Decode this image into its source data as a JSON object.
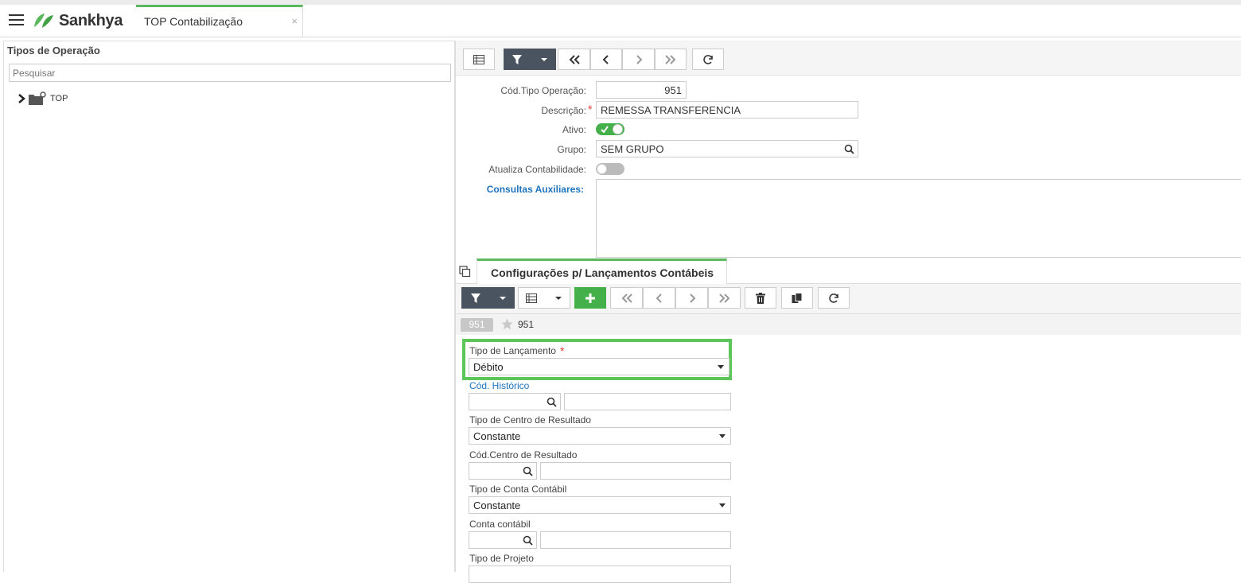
{
  "app": {
    "brand": "Sankhya",
    "tab_label": "TOP Contabilização",
    "tab_close": "×"
  },
  "left": {
    "title": "Tipos de Operação",
    "search_placeholder": "Pesquisar",
    "tree": [
      {
        "label": "TOP"
      }
    ]
  },
  "form": {
    "cod_label": "Cód.Tipo Operação:",
    "cod_value": "951",
    "desc_label": "Descrição:",
    "desc_value": "REMESSA TRANSFERENCIA",
    "ativo_label": "Ativo:",
    "ativo_on": true,
    "grupo_label": "Grupo:",
    "grupo_value": "SEM GRUPO",
    "atualiza_label": "Atualiza Contabilidade:",
    "atualiza_on": false,
    "consultas_label": "Consultas Auxiliares:"
  },
  "subtab": {
    "label": "Configurações p/ Lançamentos Contábeis"
  },
  "record": {
    "badge": "951",
    "label": "951"
  },
  "detail": {
    "tipo_lanc_label": "Tipo de Lançamento",
    "tipo_lanc_value": "Débito",
    "cod_hist_label": "Cód. Histórico",
    "tipo_centro_label": "Tipo de Centro de Resultado",
    "tipo_centro_value": "Constante",
    "cod_centro_label": "Cód.Centro de Resultado",
    "tipo_conta_label": "Tipo de Conta Contábil",
    "tipo_conta_value": "Constante",
    "conta_label": "Conta contábil",
    "tipo_projeto_label": "Tipo de Projeto"
  },
  "colors": {
    "accent_green": "#5cb85c",
    "dark_button": "#4a5360",
    "link_blue": "#1e73be",
    "required_red": "#e53935"
  }
}
